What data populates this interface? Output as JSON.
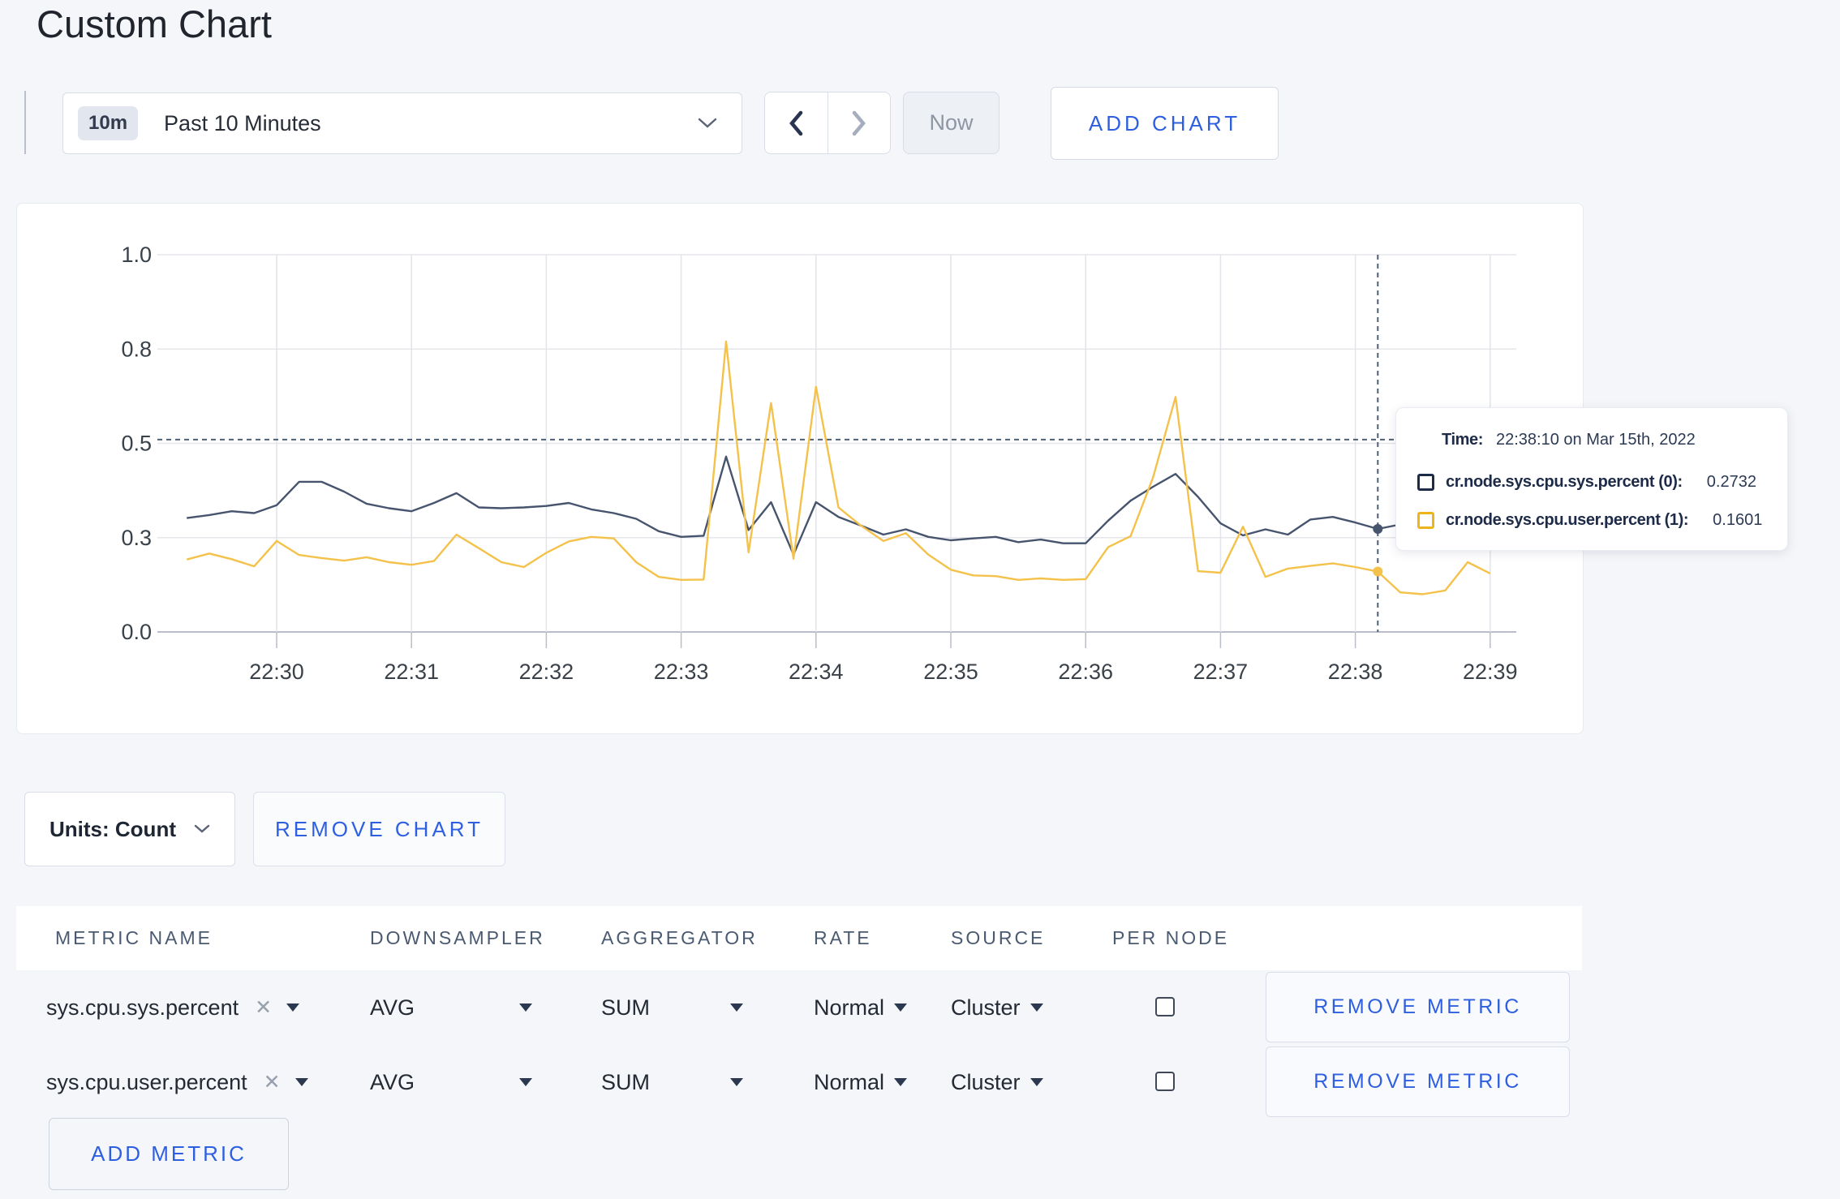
{
  "title": "Custom Chart",
  "toolbar": {
    "range_badge": "10m",
    "range_label": "Past 10 Minutes",
    "now_label": "Now",
    "add_chart_label": "ADD CHART"
  },
  "chart_data": {
    "type": "line",
    "x_ticks": [
      "22:30",
      "22:31",
      "22:32",
      "22:33",
      "22:34",
      "22:35",
      "22:36",
      "22:37",
      "22:38",
      "22:39"
    ],
    "y_tick_labels": [
      "0.0",
      "0.3",
      "0.5",
      "0.8",
      "1.0"
    ],
    "y_tick_values": [
      0,
      0.25,
      0.5,
      0.75,
      1.0
    ],
    "ylim": [
      0,
      1.0
    ],
    "start_offset_seconds": -40,
    "interval_seconds": 10,
    "grid": true,
    "highlight_index": 53,
    "crosshair": {
      "time": "22:38:10",
      "y_value": 0.51
    },
    "series": [
      {
        "name": "cr.node.sys.cpu.sys.percent (0)",
        "color": "#46546e",
        "values": [
          0.302,
          0.31,
          0.32,
          0.315,
          0.336,
          0.398,
          0.398,
          0.372,
          0.34,
          0.328,
          0.32,
          0.342,
          0.368,
          0.33,
          0.328,
          0.33,
          0.334,
          0.342,
          0.325,
          0.315,
          0.3,
          0.267,
          0.252,
          0.255,
          0.465,
          0.27,
          0.344,
          0.205,
          0.344,
          0.305,
          0.282,
          0.258,
          0.272,
          0.252,
          0.243,
          0.248,
          0.252,
          0.238,
          0.245,
          0.235,
          0.235,
          0.295,
          0.348,
          0.385,
          0.419,
          0.358,
          0.288,
          0.256,
          0.272,
          0.258,
          0.298,
          0.305,
          0.29,
          0.2732,
          0.285,
          0.288,
          0.284,
          0.29,
          0.286
        ]
      },
      {
        "name": "cr.node.sys.cpu.user.percent (1)",
        "color": "#f4c24a",
        "values": [
          0.192,
          0.208,
          0.193,
          0.174,
          0.241,
          0.204,
          0.196,
          0.189,
          0.198,
          0.185,
          0.178,
          0.188,
          0.258,
          0.222,
          0.185,
          0.172,
          0.21,
          0.24,
          0.252,
          0.248,
          0.185,
          0.146,
          0.138,
          0.139,
          0.77,
          0.211,
          0.607,
          0.194,
          0.65,
          0.33,
          0.282,
          0.241,
          0.262,
          0.205,
          0.165,
          0.15,
          0.148,
          0.138,
          0.142,
          0.138,
          0.14,
          0.225,
          0.254,
          0.41,
          0.623,
          0.161,
          0.157,
          0.279,
          0.146,
          0.168,
          0.175,
          0.182,
          0.172,
          0.1601,
          0.105,
          0.1,
          0.11,
          0.185,
          0.155
        ]
      }
    ]
  },
  "tooltip": {
    "time_label": "Time:",
    "time_value": "22:38:10 on Mar 15th, 2022",
    "series": [
      {
        "name": "cr.node.sys.cpu.sys.percent (0):",
        "value": "0.2732",
        "color": "#1d2b49"
      },
      {
        "name": "cr.node.sys.cpu.user.percent (1):",
        "value": "0.1601",
        "color": "#eeb41c"
      }
    ]
  },
  "units": {
    "label": "Units: Count",
    "remove_chart_label": "REMOVE CHART"
  },
  "metrics_table": {
    "headers": [
      "METRIC NAME",
      "DOWNSAMPLER",
      "AGGREGATOR",
      "RATE",
      "SOURCE",
      "PER NODE"
    ],
    "rows": [
      {
        "metric": "sys.cpu.sys.percent",
        "downsampler": "AVG",
        "aggregator": "SUM",
        "rate": "Normal",
        "source": "Cluster",
        "per_node": false,
        "remove_label": "REMOVE METRIC"
      },
      {
        "metric": "sys.cpu.user.percent",
        "downsampler": "AVG",
        "aggregator": "SUM",
        "rate": "Normal",
        "source": "Cluster",
        "per_node": false,
        "remove_label": "REMOVE METRIC"
      }
    ],
    "add_metric_label": "ADD METRIC"
  }
}
